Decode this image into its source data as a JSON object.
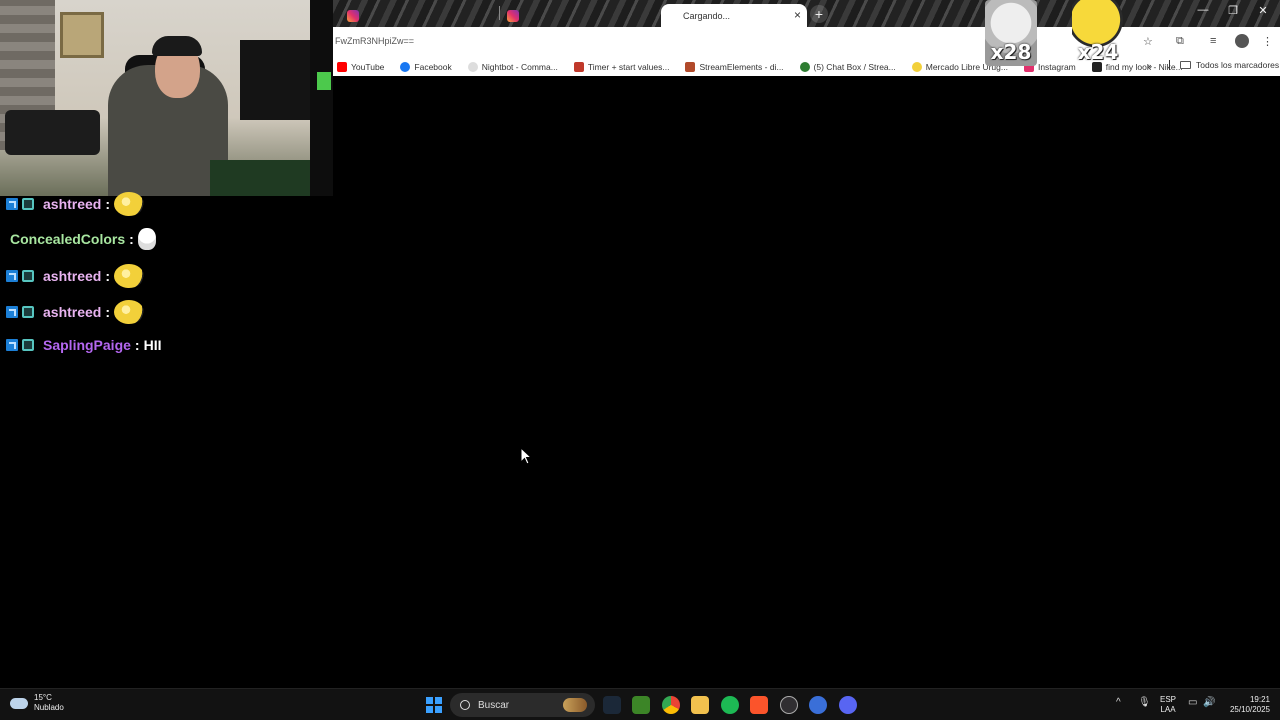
{
  "browser": {
    "tabs": [
      {
        "label": "",
        "icon": "instagram-icon"
      },
      {
        "label": "",
        "icon": "instagram-icon"
      },
      {
        "label": "Cargando...",
        "icon": "loading-icon",
        "active": true
      }
    ],
    "new_tab": "+",
    "window_controls": {
      "minimize": "—",
      "maximize": "❐",
      "close": "✕"
    },
    "url": "FwZmR3NHpiZw==",
    "bookmarks": [
      {
        "label": "YouTube",
        "color": "#ff0000"
      },
      {
        "label": "Facebook",
        "color": "#1877f2"
      },
      {
        "label": "Nightbot - Comma...",
        "color": "#dddddd"
      },
      {
        "label": "Timer + start values...",
        "color": "#c0392b"
      },
      {
        "label": "StreamElements - di...",
        "color": "#b14a2a"
      },
      {
        "label": "(5) Chat Box / Strea...",
        "color": "#2e7d32"
      },
      {
        "label": "Mercado Libre Urug...",
        "color": "#f2d03a"
      },
      {
        "label": "Instagram",
        "color": "#e1306c"
      },
      {
        "label": "find my look - Nike...",
        "color": "#222222"
      }
    ],
    "bookmarks_more": "»",
    "all_bookmarks": "Todos los marcadores"
  },
  "overlay": {
    "sticker_a": "x28",
    "sticker_b": "x24"
  },
  "chat": {
    "messages": [
      {
        "user": "ashtreed",
        "color": "#e8b3f0",
        "emote": "bee",
        "text": "",
        "badges": true
      },
      {
        "user": "ConcealedColors",
        "color": "#a8e6a0",
        "emote": "duck",
        "text": "",
        "badges": false
      },
      {
        "user": "ashtreed",
        "color": "#e8b3f0",
        "emote": "bee",
        "text": "",
        "badges": true
      },
      {
        "user": "ashtreed",
        "color": "#e8b3f0",
        "emote": "bee",
        "text": "",
        "badges": true
      },
      {
        "user": "SaplingPaige",
        "color": "#b467f0",
        "emote": "",
        "text": "HII",
        "badges": true
      }
    ],
    "separator": ":"
  },
  "taskbar": {
    "weather_temp": "15°C",
    "weather_desc": "Nublado",
    "search_placeholder": "Buscar",
    "lang_top": "ESP",
    "lang_bottom": "LAA",
    "time": "19:21",
    "date": "25/10/2025",
    "apps": [
      {
        "name": "steam",
        "color": "#1b2838"
      },
      {
        "name": "minecraft",
        "color": "#3c8527"
      },
      {
        "name": "chrome",
        "color": "#4285f4"
      },
      {
        "name": "file-explorer",
        "color": "#f2c14e"
      },
      {
        "name": "spotify",
        "color": "#1db954"
      },
      {
        "name": "brave",
        "color": "#fb542b"
      },
      {
        "name": "obs",
        "color": "#302e31"
      },
      {
        "name": "app-blue",
        "color": "#3a6fd8"
      },
      {
        "name": "discord",
        "color": "#5865f2"
      }
    ]
  }
}
